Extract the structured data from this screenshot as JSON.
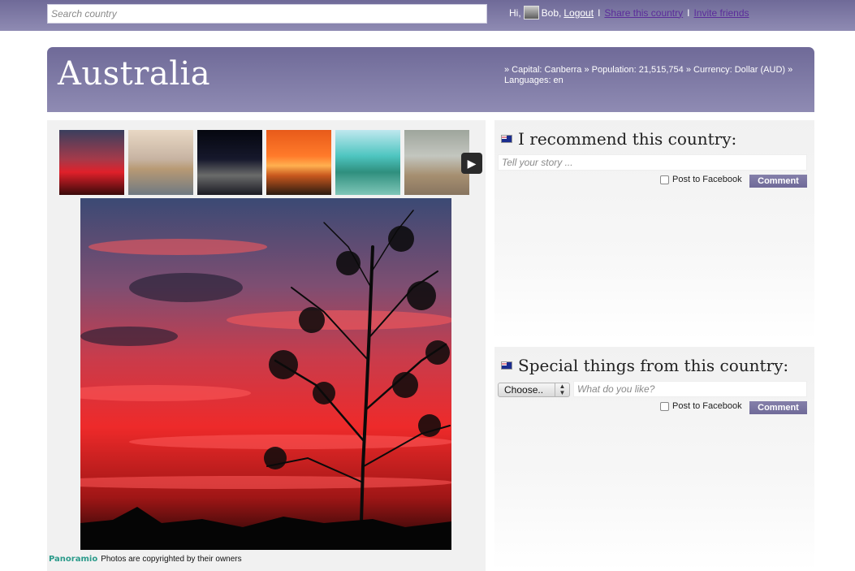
{
  "topbar": {
    "search_placeholder": "Search country",
    "greeting": "Hi,",
    "username": "Bob,",
    "logout": "Logout",
    "separator": "I",
    "share": "Share this country",
    "invite": "Invite friends"
  },
  "country": {
    "name": "Australia",
    "facts_line1": "» Capital: Canberra » Population: 21,515,754 » Currency: Dollar (AUD) »",
    "facts_line2": "Languages: en"
  },
  "gallery": {
    "thumbnails": [
      {
        "name": "thumb-sunset-tree"
      },
      {
        "name": "thumb-sydney-skyline"
      },
      {
        "name": "thumb-night-harbour"
      },
      {
        "name": "thumb-camel-sunset"
      },
      {
        "name": "thumb-reef"
      },
      {
        "name": "thumb-kangaroo"
      }
    ],
    "next_icon": "chevron-right-icon",
    "credit_logo": "Panoramio",
    "credit_text": "Photos are copyrighted by their owners"
  },
  "recommend": {
    "title": "I recommend this country:",
    "story_placeholder": "Tell your story ...",
    "post_facebook": "Post to Facebook",
    "comment": "Comment"
  },
  "special": {
    "title": "Special things from this country:",
    "select_value": "Choose..",
    "like_placeholder": "What do you like?",
    "post_facebook": "Post to Facebook",
    "comment": "Comment"
  },
  "colors": {
    "accent": "#7a75a3",
    "link_purple": "#5b2c9a"
  }
}
